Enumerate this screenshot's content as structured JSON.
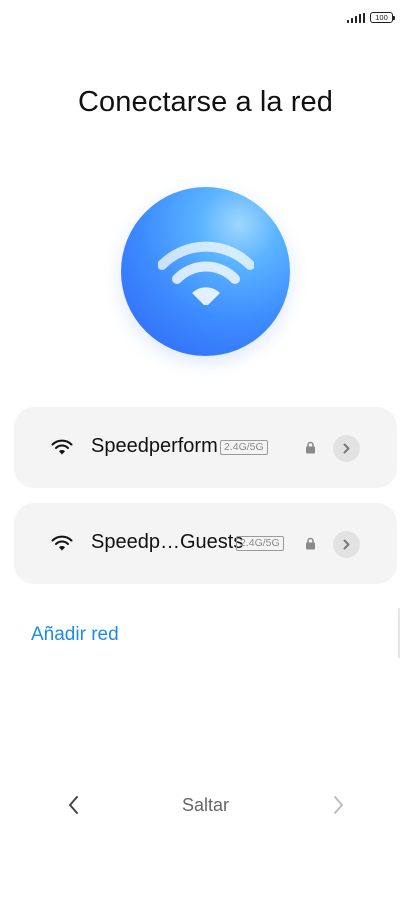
{
  "status_bar": {
    "signal_icon": "cellular-signal-icon",
    "battery_level": "100"
  },
  "page": {
    "title": "Conectarse a la red"
  },
  "hero": {
    "icon": "wifi-icon",
    "colors": [
      "#9fd7ff",
      "#3d8cff",
      "#2f63f5"
    ]
  },
  "networks": [
    {
      "name": "Speedperform",
      "band": "2.4G/5G",
      "secured": true,
      "icon": "wifi-icon"
    },
    {
      "name": "Speedp…Guests",
      "band": "2.4G/5G",
      "secured": true,
      "icon": "wifi-icon"
    }
  ],
  "actions": {
    "add_network": "Añadir red"
  },
  "footer": {
    "skip_label": "Saltar",
    "back_icon": "chevron-left-icon",
    "next_icon": "chevron-right-icon"
  },
  "colors": {
    "accent": "#1d8ce8",
    "card_bg": "#f4f4f4"
  }
}
